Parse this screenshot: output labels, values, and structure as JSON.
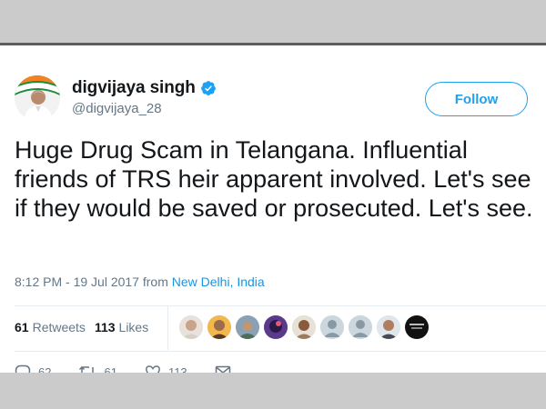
{
  "tweet": {
    "display_name": "digvijaya singh",
    "handle": "@digvijaya_28",
    "follow_label": "Follow",
    "text": "Huge Drug Scam in Telangana. Influential friends of TRS heir apparent involved. Let's see if they would be saved or prosecuted. Let's see.",
    "timestamp": "8:12 PM - 19 Jul 2017 from ",
    "location": "New Delhi, India"
  },
  "stats": {
    "retweets_count": "61",
    "retweets_label": "Retweets",
    "likes_count": "113",
    "likes_label": "Likes"
  },
  "actions": {
    "replies": "62",
    "retweets": "61",
    "likes": "113"
  },
  "icons": [
    "verified-badge-icon",
    "reply-icon",
    "retweet-icon",
    "like-icon",
    "message-icon"
  ],
  "colors": {
    "accent": "#1da1f2",
    "link": "#1b95e0",
    "muted": "#657786",
    "text": "#14171a"
  }
}
